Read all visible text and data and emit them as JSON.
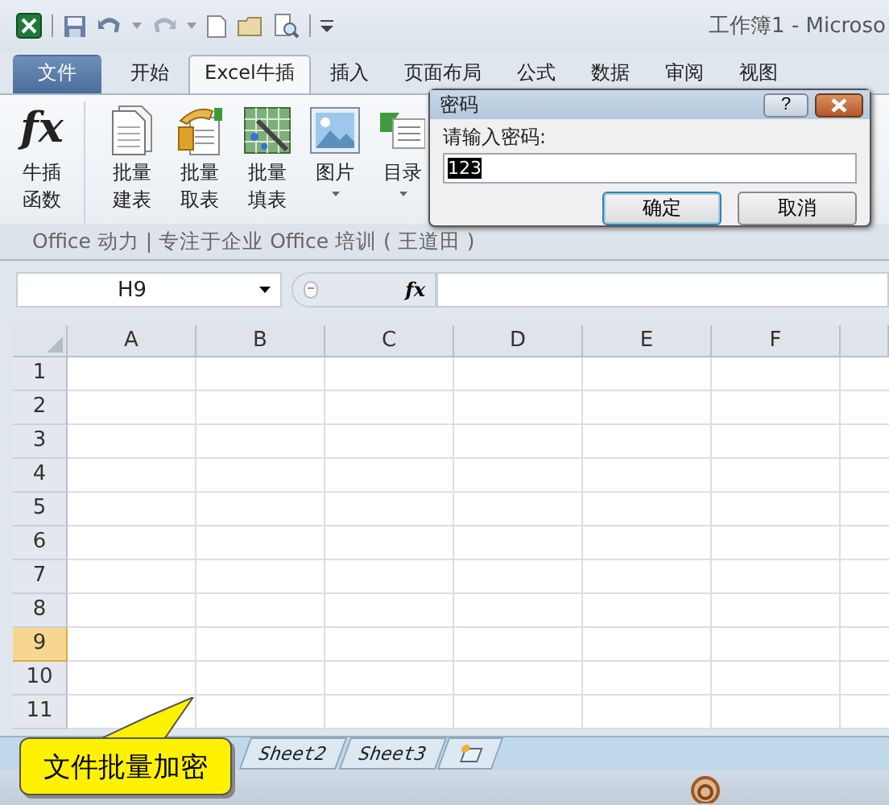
{
  "title_bar": {
    "title": "工作簿1 - Microso"
  },
  "tabs": [
    {
      "label": "文件",
      "kind": "file",
      "selected": false
    },
    {
      "label": "开始",
      "kind": "tab",
      "selected": false
    },
    {
      "label": "Excel牛插",
      "kind": "tab",
      "selected": true
    },
    {
      "label": "插入",
      "kind": "tab",
      "selected": false
    },
    {
      "label": "页面布局",
      "kind": "tab",
      "selected": false
    },
    {
      "label": "公式",
      "kind": "tab",
      "selected": false
    },
    {
      "label": "数据",
      "kind": "tab",
      "selected": false
    },
    {
      "label": "审阅",
      "kind": "tab",
      "selected": false
    },
    {
      "label": "视图",
      "kind": "tab",
      "selected": false
    }
  ],
  "ribbon": {
    "buttons": [
      {
        "kind": "function",
        "icon_text": "fx",
        "lines": [
          "牛插",
          "函数"
        ],
        "dropdown": false
      },
      {
        "kind": "document",
        "lines": [
          "批量",
          "建表"
        ],
        "dropdown": false
      },
      {
        "kind": "fetch",
        "lines": [
          "批量",
          "取表"
        ],
        "dropdown": false
      },
      {
        "kind": "fill",
        "lines": [
          "批量",
          "填表"
        ],
        "dropdown": false
      },
      {
        "kind": "picture",
        "lines": [
          "图片"
        ],
        "dropdown": true
      },
      {
        "kind": "toc",
        "lines": [
          "目录"
        ],
        "dropdown": true
      }
    ],
    "group_label": "Office 动力 | 专注于企业 Office 培训 ( 王道田 )"
  },
  "formula_bar": {
    "name_box": "H9",
    "fx": "fx"
  },
  "sheet": {
    "columns": [
      "A",
      "B",
      "C",
      "D",
      "E",
      "F"
    ],
    "rows": [
      {
        "label": "1",
        "selected": false
      },
      {
        "label": "2",
        "selected": false
      },
      {
        "label": "3",
        "selected": false
      },
      {
        "label": "4",
        "selected": false
      },
      {
        "label": "5",
        "selected": false
      },
      {
        "label": "6",
        "selected": false
      },
      {
        "label": "7",
        "selected": false
      },
      {
        "label": "8",
        "selected": false
      },
      {
        "label": "9",
        "selected": true
      },
      {
        "label": "10",
        "selected": false
      },
      {
        "label": "11",
        "selected": false
      }
    ]
  },
  "sheet_tabs": [
    {
      "label": "Sheet2"
    },
    {
      "label": "Sheet3"
    }
  ],
  "callout": {
    "text": "文件批量加密"
  },
  "dialog": {
    "title": "密码",
    "help": "?",
    "prompt": "请输入密码:",
    "value": "123",
    "buttons": [
      {
        "label": "确定",
        "default": true
      },
      {
        "label": "取消",
        "default": false
      }
    ]
  }
}
